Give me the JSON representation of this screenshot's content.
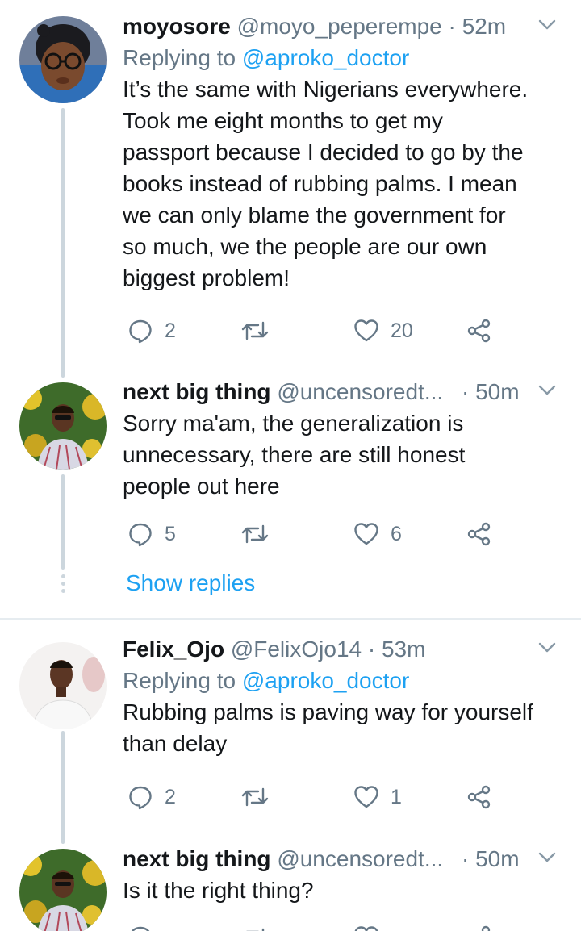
{
  "tweets": [
    {
      "name": "moyosore",
      "handle": "@moyo_peperempe",
      "time": "· 52m",
      "replying_label": "Replying to",
      "replying_to": "@aproko_doctor",
      "lines": [
        "It’s the same with Nigerians everywhere.",
        "Took me eight months to get my",
        "passport because I decided to go by the",
        "books instead of rubbing palms. I mean",
        "we can only blame the government for",
        "so much, we the people are our own",
        "biggest problem!"
      ],
      "replies": "2",
      "retweets": "",
      "likes": "20"
    },
    {
      "name": "next big thing",
      "handle": "@uncensoredt...",
      "time": "· 50m",
      "lines": [
        "Sorry ma'am, the generalization is",
        "unnecessary, there are still honest",
        "people out here"
      ],
      "replies": "5",
      "retweets": "",
      "likes": "6"
    },
    {
      "name": "Felix_Ojo",
      "handle": "@FelixOjo14",
      "time": "· 53m",
      "replying_label": "Replying to",
      "replying_to": "@aproko_doctor",
      "lines": [
        "Rubbing palms is paving way for yourself",
        "than delay"
      ],
      "replies": "2",
      "retweets": "",
      "likes": "1"
    },
    {
      "name": "next big thing",
      "handle": "@uncensoredt...",
      "time": "· 50m",
      "lines": [
        "Is it the right thing?"
      ]
    }
  ],
  "show_replies": "Show replies",
  "colors": {
    "link": "#1da1f2",
    "muted": "#657786",
    "text": "#14171a",
    "thread_line": "#ccd6dd",
    "divider": "#e6ecf0"
  },
  "icons": [
    "reply-icon",
    "retweet-icon",
    "like-icon",
    "share-icon",
    "chevron-down-icon"
  ]
}
